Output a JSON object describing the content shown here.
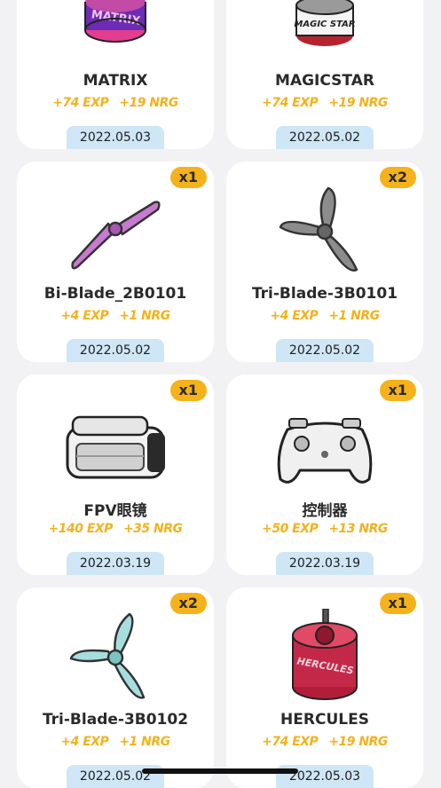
{
  "items": [
    {
      "name": "MATRIX",
      "exp": "+74 EXP",
      "nrg": "+19 NRG",
      "date": "2022.05.03"
    },
    {
      "name": "MAGICSTAR",
      "exp": "+74 EXP",
      "nrg": "+19 NRG",
      "date": "2022.05.02"
    },
    {
      "name": "Bi-Blade_2B0101",
      "exp": "+4 EXP",
      "nrg": "+1 NRG",
      "date": "2022.05.02",
      "qty": "x1",
      "icon": "bi-blade-propeller-icon"
    },
    {
      "name": "Tri-Blade-3B0101",
      "exp": "+4 EXP",
      "nrg": "+1 NRG",
      "date": "2022.05.02",
      "qty": "x2",
      "icon": "tri-blade-propeller-icon"
    },
    {
      "name": "FPV眼镜",
      "exp": "+140 EXP",
      "nrg": "+35 NRG",
      "date": "2022.03.19",
      "qty": "x1",
      "icon": "fpv-goggles-icon"
    },
    {
      "name": "控制器",
      "exp": "+50 EXP",
      "nrg": "+13 NRG",
      "date": "2022.03.19",
      "qty": "x1",
      "icon": "controller-icon"
    },
    {
      "name": "Tri-Blade-3B0102",
      "exp": "+4 EXP",
      "nrg": "+1 NRG",
      "date": "2022.05.02",
      "qty": "x2",
      "icon": "tri-blade-propeller-icon"
    },
    {
      "name": "HERCULES",
      "exp": "+74 EXP",
      "nrg": "+19 NRG",
      "date": "2022.05.03",
      "qty": "x1",
      "icon": "motor-icon"
    }
  ],
  "images": {
    "matrix_motor_label": "MATRIX",
    "magicstar_motor_label": "MAGIC STAR",
    "hercules_motor_label": "HERCULES"
  }
}
